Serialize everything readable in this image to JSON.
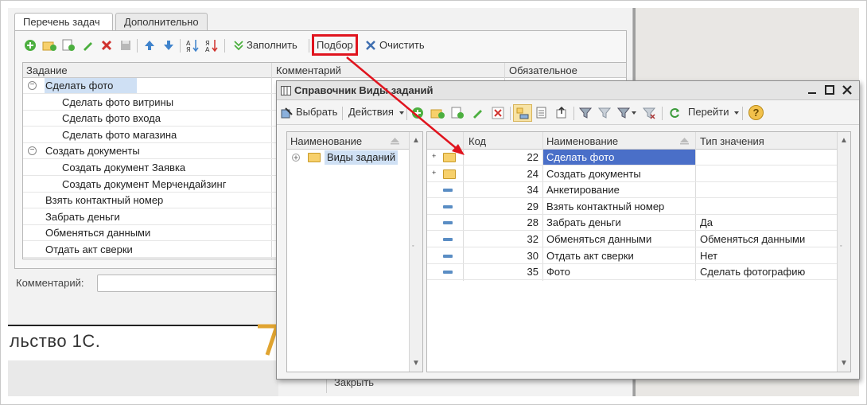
{
  "tabs": [
    "Перечень задач",
    "Дополнительно"
  ],
  "toolbar": {
    "fill_label": "Заполнить",
    "pick_label": "Подбор",
    "clear_label": "Очистить"
  },
  "grid": {
    "columns": [
      "Задание",
      "Комментарий",
      "Обязательное"
    ],
    "rows": [
      {
        "label": "Сделать фото",
        "level": 0,
        "group": true
      },
      {
        "label": "Сделать фото витрины",
        "level": 1
      },
      {
        "label": "Сделать фото входа",
        "level": 1
      },
      {
        "label": "Сделать фото магазина",
        "level": 1
      },
      {
        "label": "Создать документы",
        "level": 0,
        "group": true
      },
      {
        "label": "Создать документ Заявка",
        "level": 1
      },
      {
        "label": "Создать документ Мерчендайзинг",
        "level": 1
      },
      {
        "label": "Взять контактный номер",
        "level": 0
      },
      {
        "label": "Забрать деньги",
        "level": 0
      },
      {
        "label": "Обменяться данными",
        "level": 0
      },
      {
        "label": "Отдать акт сверки",
        "level": 0
      }
    ]
  },
  "comment_label": "Комментарий:",
  "background_text": "льство 1С.",
  "close_label": "Закрыть",
  "dialog": {
    "title": "Справочник Виды заданий",
    "select_label": "Выбрать",
    "actions_label": "Действия",
    "goto_label": "Перейти",
    "help_label": "?",
    "left_header": "Наименование",
    "tree_root": "Виды заданий",
    "columns": [
      "Код",
      "Наименование",
      "Тип значения"
    ],
    "rows": [
      {
        "code": "22",
        "name": "Сделать фото",
        "type": "",
        "folder": true
      },
      {
        "code": "24",
        "name": "Создать документы",
        "type": "",
        "folder": true
      },
      {
        "code": "34",
        "name": "Анкетирование",
        "type": ""
      },
      {
        "code": "29",
        "name": "Взять контактный номер",
        "type": ""
      },
      {
        "code": "28",
        "name": "Забрать деньги",
        "type": "Да"
      },
      {
        "code": "32",
        "name": "Обменяться данными",
        "type": "Обменяться данными"
      },
      {
        "code": "30",
        "name": "Отдать акт сверки",
        "type": "Нет"
      },
      {
        "code": "35",
        "name": "Фото",
        "type": "Сделать фотографию"
      }
    ]
  },
  "colors": {
    "accent_red": "#e0141e",
    "selection_blue": "#4a6fc8",
    "selection_light": "#cfe0f4"
  }
}
